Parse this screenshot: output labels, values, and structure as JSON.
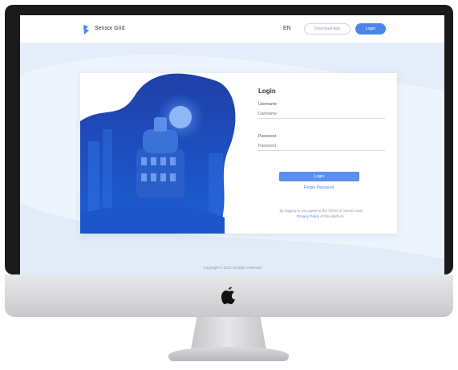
{
  "header": {
    "brand": "Sensor Grid",
    "language": "EN",
    "download_label": "Download App",
    "top_button_label": "Login"
  },
  "login": {
    "title": "Login",
    "username_label": "Username",
    "username_placeholder": "Username",
    "password_label": "Password",
    "password_placeholder": "Password",
    "submit_label": "Login",
    "forgot_label": "Forget Password",
    "note_line1": "By logging in you agree to the Terms of Service and",
    "note_line2_link": "Privacy Policy",
    "note_line2_rest": " of this platform."
  },
  "footer": {
    "text": "Copyright © 2021 All rights reserved"
  },
  "colors": {
    "accent": "#4a86e8",
    "primary_button": "#5b8ef0",
    "page_bg": "#eef4fc"
  },
  "icons": {
    "logo": "brand-logo-icon",
    "apple": "apple-logo-icon",
    "moon": "moon-icon"
  }
}
